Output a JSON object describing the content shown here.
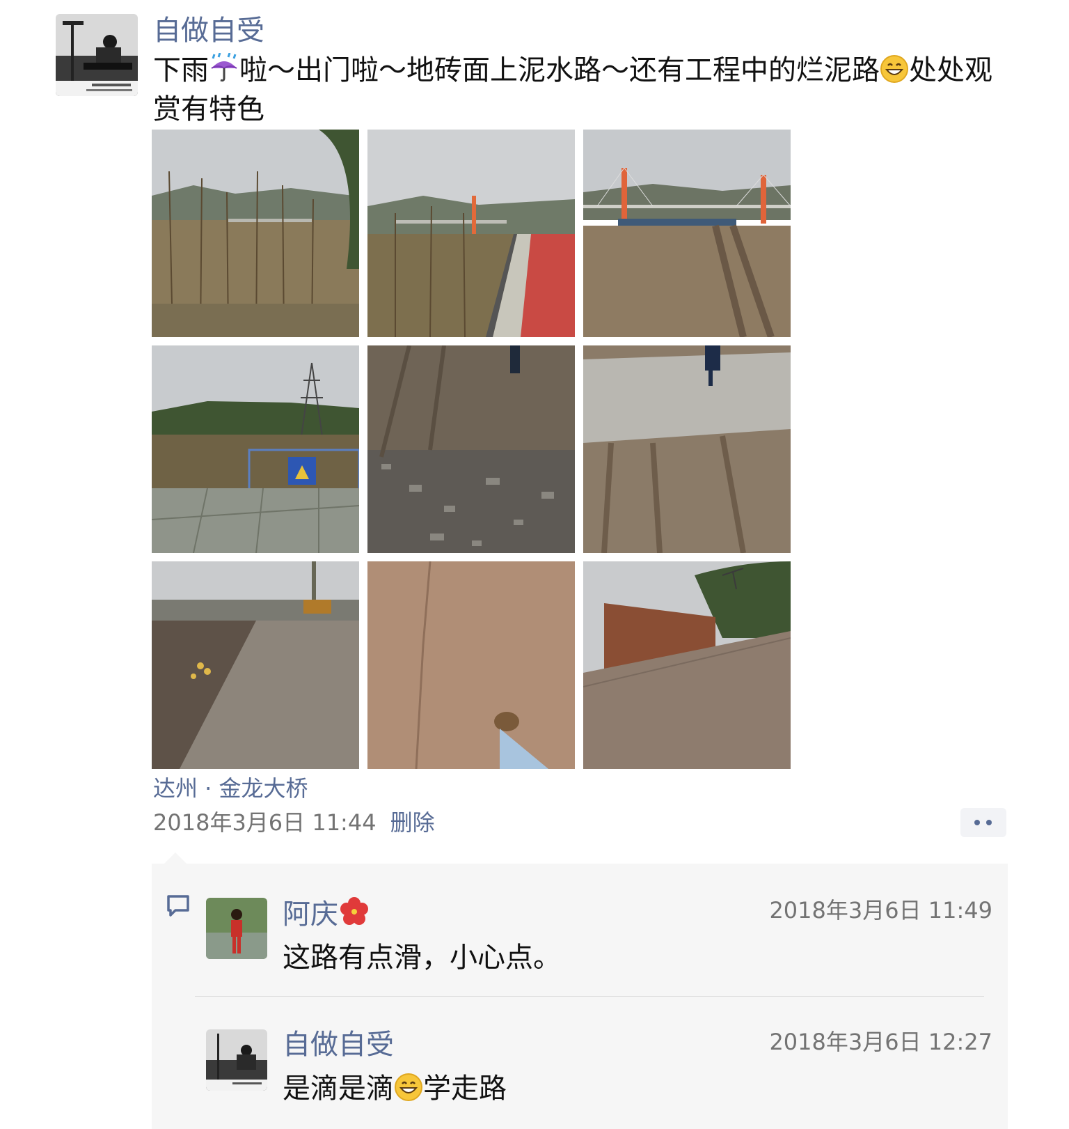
{
  "post": {
    "author": "自做自受",
    "avatar_icon": "person-at-workbench-avatar",
    "text_part1": "下雨",
    "emoji1": "umbrella-rain-emoji",
    "text_part2": "啦～出门啦～地砖面上泥水路～还有工程中的烂泥路",
    "emoji2": "grinning-face-emoji",
    "text_part3": "处处观赏有特色",
    "photos": [
      {
        "name": "photo-riverside-trees"
      },
      {
        "name": "photo-red-path-bridge"
      },
      {
        "name": "photo-muddy-bridge-site"
      },
      {
        "name": "photo-pylon-construction"
      },
      {
        "name": "photo-gravel-mud-road"
      },
      {
        "name": "photo-wet-mud-road"
      },
      {
        "name": "photo-puddle-excavator"
      },
      {
        "name": "photo-foot-on-mud"
      },
      {
        "name": "photo-brick-wall-road"
      }
    ],
    "location": "达州 · 金龙大桥",
    "time": "2018年3月6日 11:44",
    "delete_label": "删除",
    "colors": {
      "link": "#576b95",
      "meta": "#737373",
      "panel": "#f6f6f6"
    }
  },
  "comments": [
    {
      "author": "阿庆",
      "author_emoji": "hibiscus-flower-emoji",
      "time": "2018年3月6日 11:49",
      "text": "这路有点滑，小心点。"
    },
    {
      "author": "自做自受",
      "time": "2018年3月6日 12:27",
      "text_part1": "是滴是滴",
      "emoji": "grinning-face-emoji",
      "text_part2": "学走路"
    }
  ]
}
